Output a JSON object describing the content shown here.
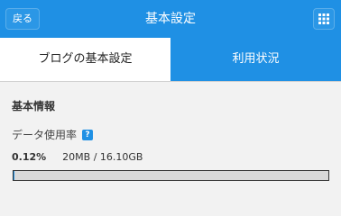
{
  "header": {
    "back_label": "戻る",
    "title": "基本設定",
    "menu_icon": "grid-icon"
  },
  "tabs": [
    {
      "label": "ブログの基本設定",
      "active": false
    },
    {
      "label": "利用状況",
      "active": true
    }
  ],
  "basic_info": {
    "section_title": "基本情報",
    "usage_label": "データ使用率",
    "help_icon_text": "?",
    "usage_percent": "0.12%",
    "usage_amount": "20MB / 16.10GB",
    "usage_fraction": 0.0012
  },
  "colors": {
    "accent": "#1f90e4"
  }
}
